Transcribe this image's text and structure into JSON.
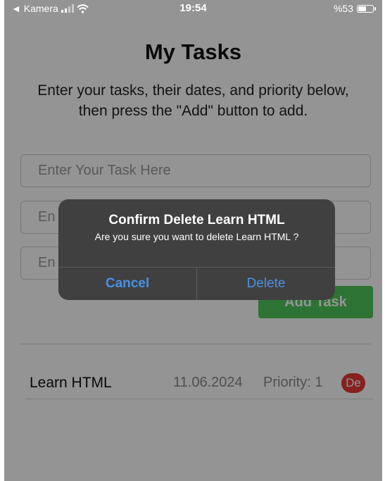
{
  "status_bar": {
    "back_label": "◄ Kamera",
    "time": "19:54",
    "battery": "%53"
  },
  "header": {
    "title": "My Tasks",
    "subtitle": "Enter your tasks, their dates, and priority below, then press the \"Add\" button to add."
  },
  "form": {
    "task_placeholder": "Enter Your Task Here",
    "date_placeholder": "En",
    "priority_placeholder": "En",
    "add_button": "Add Task"
  },
  "tasks": [
    {
      "name": "Learn HTML",
      "date": "11.06.2024",
      "priority": "Priority: 1",
      "delete_label": "De"
    }
  ],
  "dialog": {
    "title": "Confirm Delete Learn HTML",
    "message": "Are you sure you want to delete Learn HTML ?",
    "cancel_label": "Cancel",
    "delete_label": "Delete"
  },
  "colors": {
    "accent": "#4a90e2",
    "add_button": "#4fc85a",
    "delete_badge": "#e53935",
    "dialog_bg": "#404040"
  }
}
